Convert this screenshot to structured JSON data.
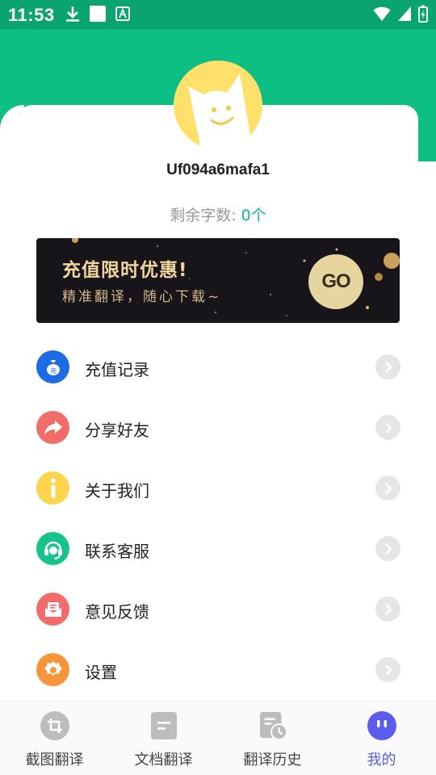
{
  "status_bar": {
    "time": "11:53",
    "left_icons": [
      "download-icon",
      "blank-notification-icon",
      "translate-app-icon"
    ],
    "right_icons": [
      "wifi-icon",
      "signal-icon",
      "battery-charging-icon"
    ]
  },
  "profile": {
    "username": "Uf094a6mafa1",
    "remaining_label": "剩余字数: ",
    "remaining_count": "0个"
  },
  "banner": {
    "title": "充值限时优惠!",
    "subtitle": "精准翻译，随心下载~",
    "button": "GO"
  },
  "menu": {
    "items": [
      {
        "label": "充值记录",
        "icon": "money-bag-icon",
        "color": "#1e6be6"
      },
      {
        "label": "分享好友",
        "icon": "share-icon",
        "color": "#f26c6c"
      },
      {
        "label": "关于我们",
        "icon": "info-icon",
        "color": "#fcd54c"
      },
      {
        "label": "联系客服",
        "icon": "headset-icon",
        "color": "#16c48a"
      },
      {
        "label": "意见反馈",
        "icon": "feedback-mail-icon",
        "color": "#f26c6c"
      },
      {
        "label": "设置",
        "icon": "gear-icon",
        "color": "#f7953b"
      }
    ]
  },
  "tabs": [
    {
      "label": "截图翻译",
      "icon": "crop-icon",
      "active": false
    },
    {
      "label": "文档翻译",
      "icon": "document-icon",
      "active": false
    },
    {
      "label": "翻译历史",
      "icon": "history-icon",
      "active": false
    },
    {
      "label": "我的",
      "icon": "profile-face-icon",
      "active": true
    }
  ],
  "colors": {
    "header": "#0dbf83",
    "accent": "#10b981",
    "active_tab": "#5b5bf0",
    "banner_bg": "#17151a",
    "banner_gold": "#f1d59d"
  }
}
